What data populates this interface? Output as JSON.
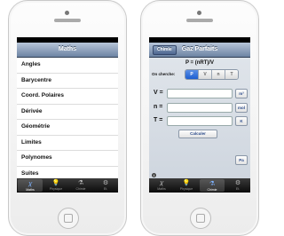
{
  "left_screen": {
    "nav_title": "Maths",
    "items": [
      "Angles",
      "Barycentre",
      "Coord. Polaires",
      "Dérivée",
      "Géométrie",
      "Limites",
      "Polynomes",
      "Suites"
    ]
  },
  "right_screen": {
    "nav_title": "Gaz Parfaits",
    "back_label": "Chimie",
    "formula": "P = (nRT)/V",
    "on_cherche_label": "On cherche:",
    "segments": [
      "P",
      "V",
      "n",
      "T"
    ],
    "selected_segment": "P",
    "fields": [
      {
        "label": "V =",
        "unit": "m³"
      },
      {
        "label": "n =",
        "unit": "mol"
      },
      {
        "label": "T =",
        "unit": "K"
      }
    ],
    "calculate_label": "Calculer",
    "result_unit": "Pa",
    "info_glyph": "i"
  },
  "tabbar": {
    "tabs": [
      {
        "label": "Maths",
        "icon": "x-icon",
        "glyph": "𝜒"
      },
      {
        "label": "Physique",
        "icon": "bulb-icon",
        "glyph": "💡"
      },
      {
        "label": "Chimie",
        "icon": "flask-icon",
        "glyph": "⚗"
      },
      {
        "label": "Et.",
        "icon": "gear-icon",
        "glyph": "⚙"
      }
    ],
    "left_active": "Maths",
    "right_active": "Chimie"
  },
  "colors": {
    "accent": "#1e5fd0",
    "nav": "#6d84a3"
  }
}
